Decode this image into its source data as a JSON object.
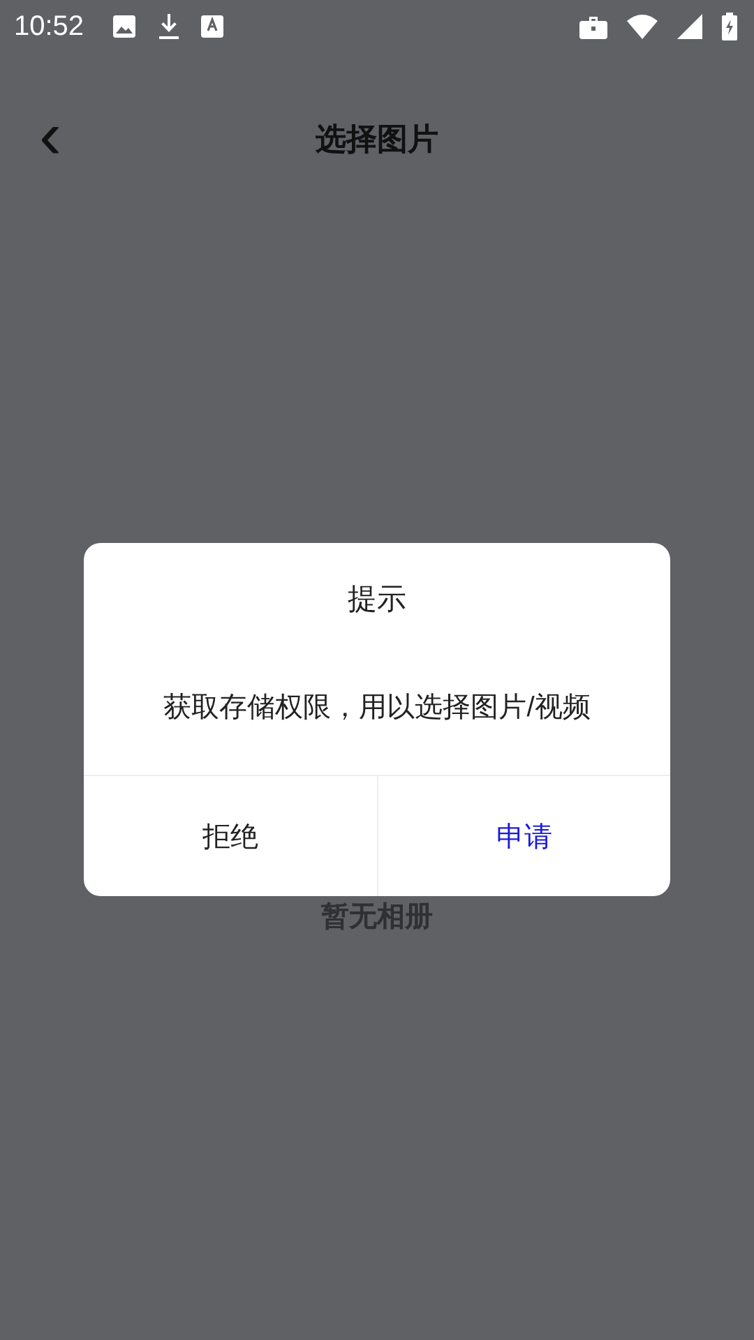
{
  "status_bar": {
    "time": "10:52"
  },
  "header": {
    "back": "‹",
    "title": "选择图片"
  },
  "empty_text": "暂无相册",
  "dialog": {
    "title": "提示",
    "message": "获取存储权限，用以选择图片/视频",
    "buttons": [
      {
        "label": "拒绝",
        "kind": "cancel"
      },
      {
        "label": "申请",
        "kind": "confirm"
      }
    ]
  }
}
